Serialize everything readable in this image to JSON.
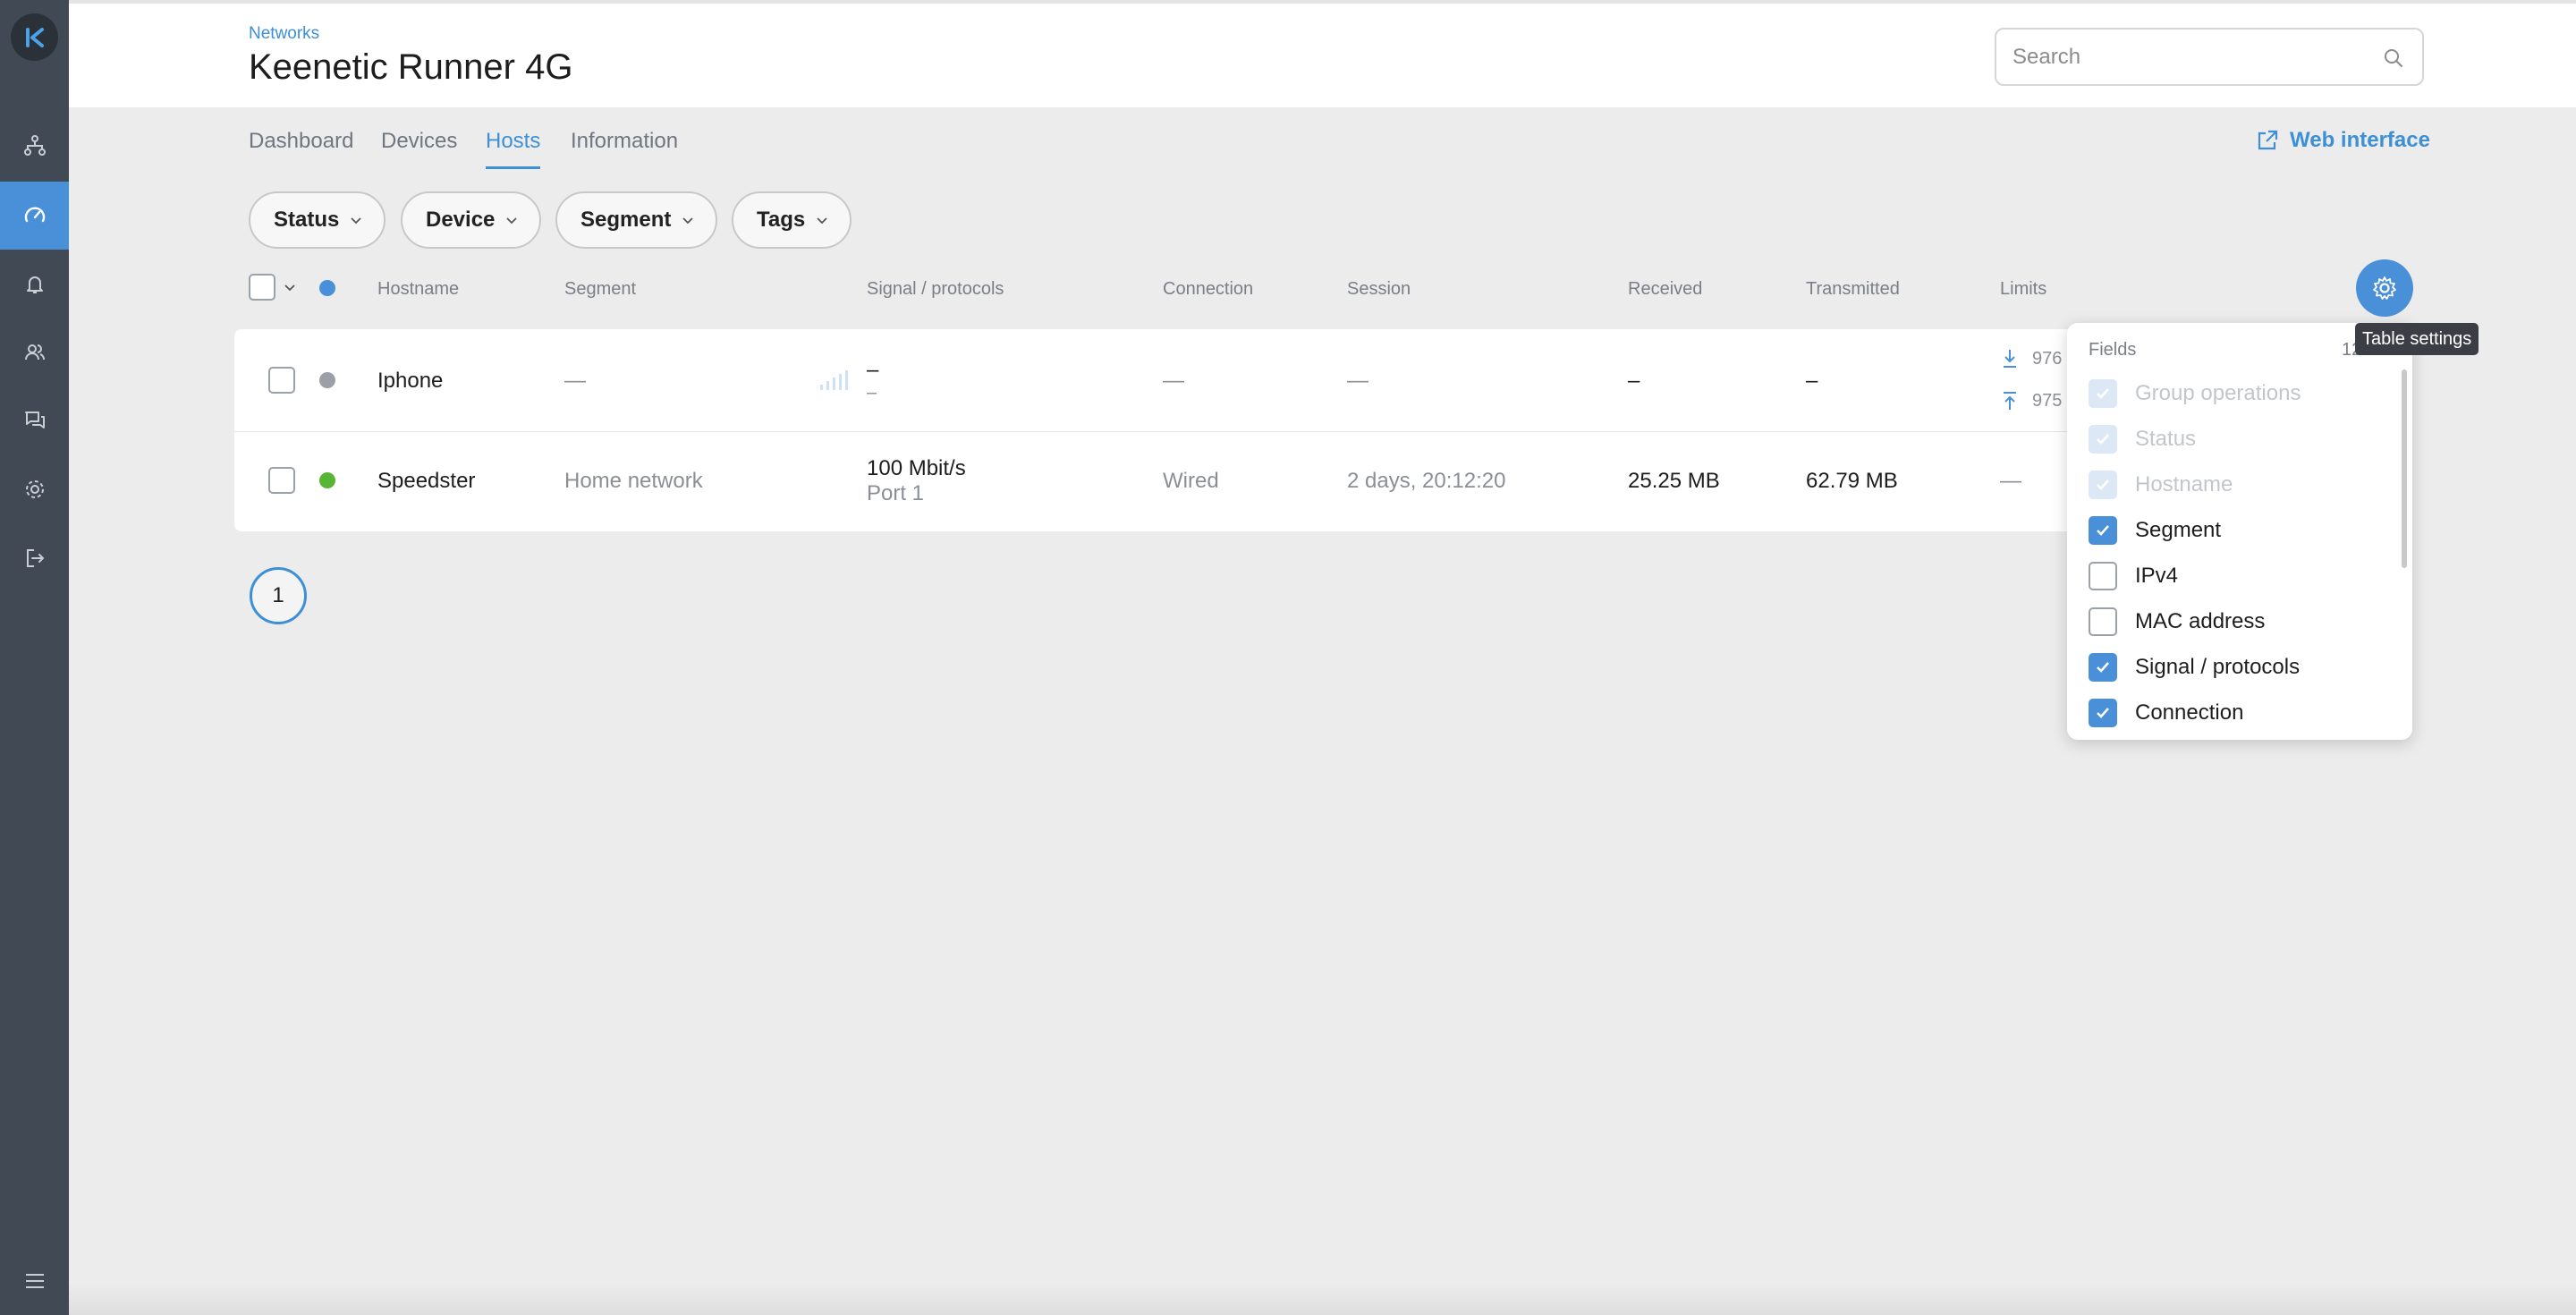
{
  "header": {
    "breadcrumb": "Networks",
    "title": "Keenetic Runner 4G",
    "search_placeholder": "Search"
  },
  "tabs": [
    {
      "label": "Dashboard"
    },
    {
      "label": "Devices"
    },
    {
      "label": "Hosts"
    },
    {
      "label": "Information"
    }
  ],
  "web_interface_label": "Web interface",
  "filters": [
    "Status",
    "Device",
    "Segment",
    "Tags"
  ],
  "columns": [
    "Hostname",
    "Segment",
    "Signal / protocols",
    "Connection",
    "Session",
    "Received",
    "Transmitted",
    "Limits"
  ],
  "rows": [
    {
      "status_color": "#9aa0a6",
      "hostname": "Iphone",
      "segment": "—",
      "signal_line1": "–",
      "signal_line2": "–",
      "connection": "—",
      "session": "—",
      "received": "–",
      "transmitted": "–",
      "limit_down": "976",
      "limit_up": "975"
    },
    {
      "status_color": "#57b534",
      "hostname": "Speedster",
      "segment": "Home network",
      "signal_line1": "100 Mbit/s",
      "signal_line2": "Port 1",
      "connection": "Wired",
      "session": "2 days, 20:12:20",
      "received": "25.25 MB",
      "transmitted": "62.79 MB",
      "limit": "—"
    }
  ],
  "pagination": {
    "current": "1"
  },
  "table_settings": {
    "tooltip": "Table settings",
    "fields_label": "Fields",
    "count": "12",
    "options": [
      {
        "label": "Group operations",
        "state": "disabled"
      },
      {
        "label": "Status",
        "state": "disabled"
      },
      {
        "label": "Hostname",
        "state": "disabled"
      },
      {
        "label": "Segment",
        "state": "checked"
      },
      {
        "label": "IPv4",
        "state": "unchecked"
      },
      {
        "label": "MAC address",
        "state": "unchecked"
      },
      {
        "label": "Signal / protocols",
        "state": "checked"
      },
      {
        "label": "Connection",
        "state": "checked"
      }
    ]
  },
  "colors": {
    "accent": "#4a90d9",
    "sidebar": "#414954"
  }
}
